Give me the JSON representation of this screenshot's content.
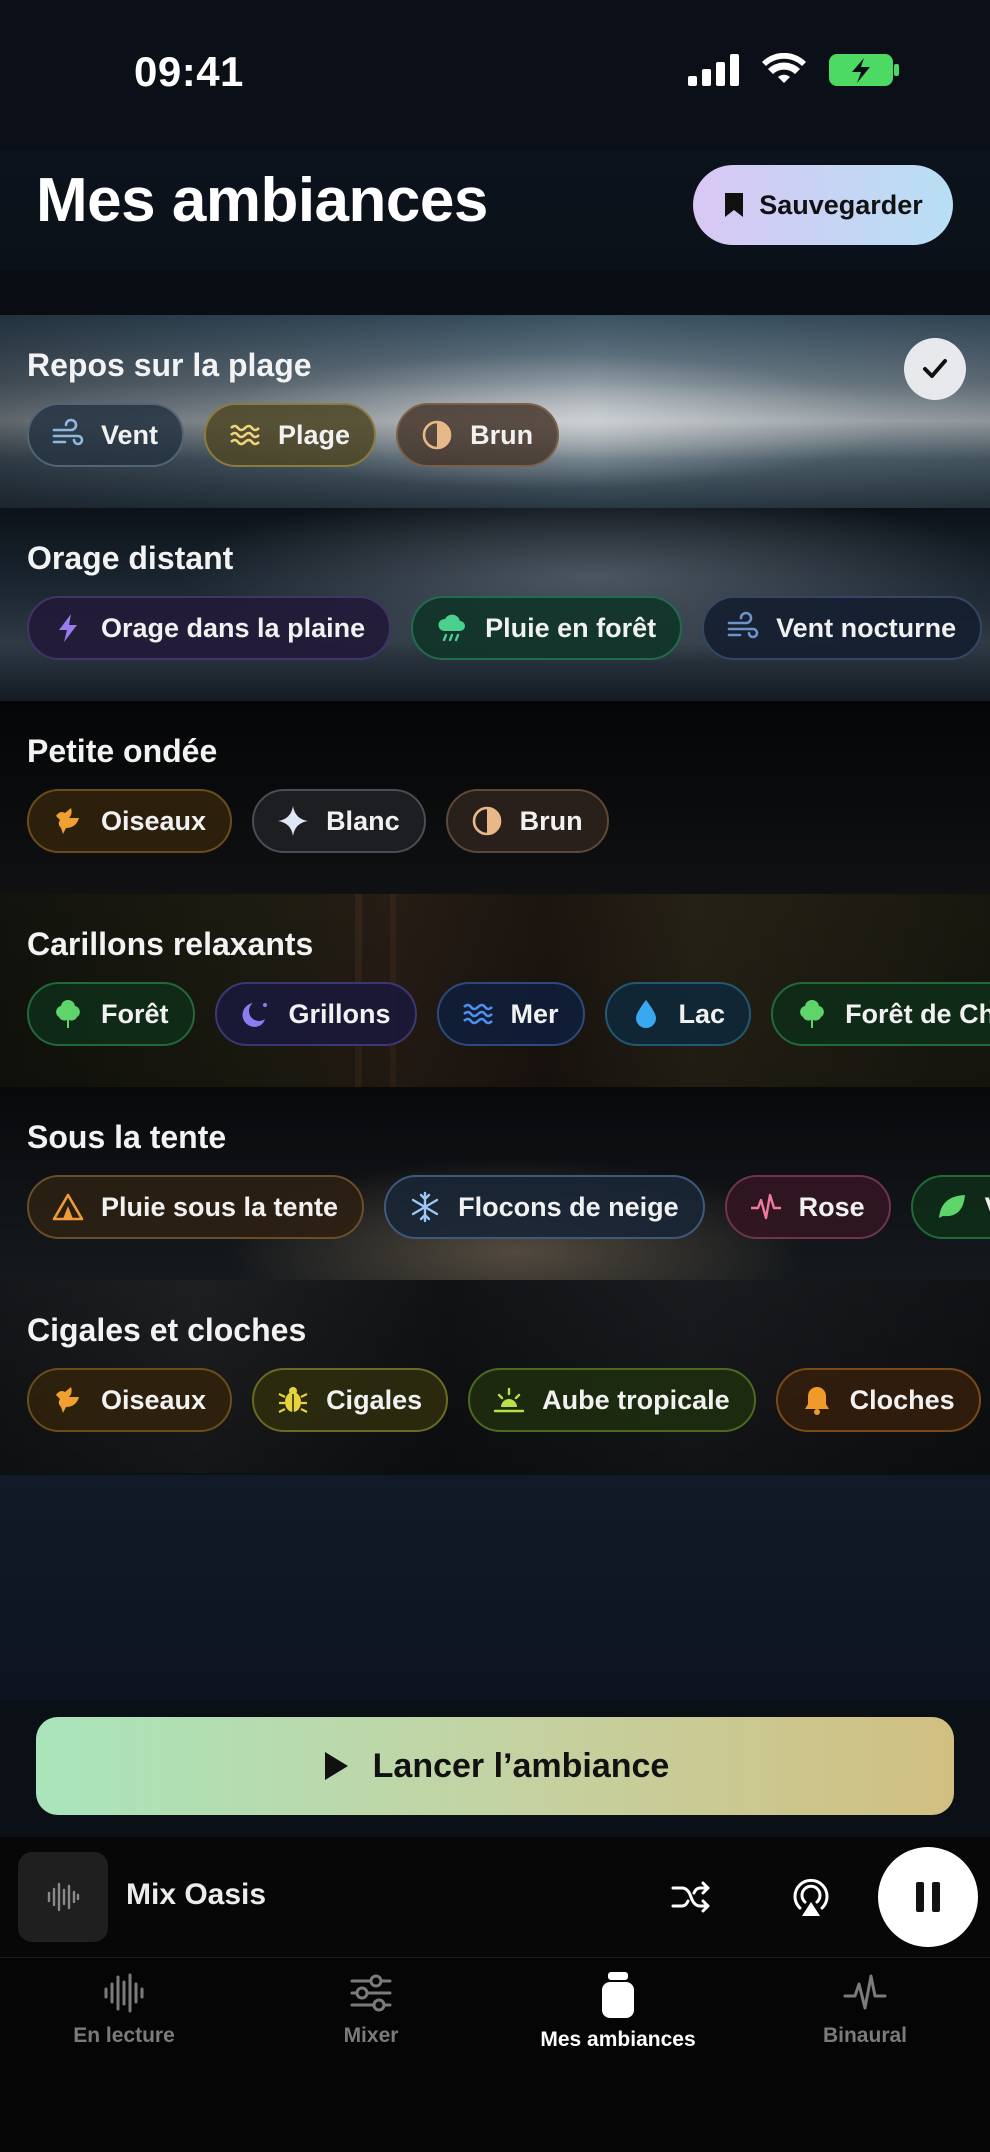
{
  "status_bar": {
    "time": "09:41"
  },
  "header": {
    "title": "Mes ambiances",
    "save_label": "Sauvegarder"
  },
  "ambiances": [
    {
      "title": "Repos sur la plage",
      "selected": true,
      "tags": [
        {
          "label": "Vent",
          "icon": "wind-icon"
        },
        {
          "label": "Plage",
          "icon": "beach-waves-icon"
        },
        {
          "label": "Brun",
          "icon": "half-circle-icon"
        }
      ]
    },
    {
      "title": "Orage distant",
      "tags": [
        {
          "label": "Orage dans la plaine",
          "icon": "lightning-icon"
        },
        {
          "label": "Pluie en forêt",
          "icon": "rain-cloud-icon"
        },
        {
          "label": "Vent nocturne",
          "icon": "wind-icon"
        }
      ]
    },
    {
      "title": "Petite ondée",
      "tags": [
        {
          "label": "Oiseaux",
          "icon": "bird-icon"
        },
        {
          "label": "Blanc",
          "icon": "sparkle-icon"
        },
        {
          "label": "Brun",
          "icon": "half-circle-icon"
        }
      ]
    },
    {
      "title": "Carillons relaxants",
      "tags": [
        {
          "label": "Forêt",
          "icon": "tree-icon"
        },
        {
          "label": "Grillons",
          "icon": "moon-stars-icon"
        },
        {
          "label": "Mer",
          "icon": "waves-icon"
        },
        {
          "label": "Lac",
          "icon": "drop-icon"
        },
        {
          "label": "Forêt de Chil",
          "icon": "tree-icon"
        }
      ]
    },
    {
      "title": "Sous la tente",
      "tags": [
        {
          "label": "Pluie sous la tente",
          "icon": "tent-icon"
        },
        {
          "label": "Flocons de neige",
          "icon": "snowflake-icon"
        },
        {
          "label": "Rose",
          "icon": "pulse-icon"
        },
        {
          "label": "Ve",
          "icon": "leaf-icon"
        }
      ]
    },
    {
      "title": "Cigales et cloches",
      "tags": [
        {
          "label": "Oiseaux",
          "icon": "bird-icon"
        },
        {
          "label": "Cigales",
          "icon": "bug-icon"
        },
        {
          "label": "Aube tropicale",
          "icon": "sunrise-icon"
        },
        {
          "label": "Cloches",
          "icon": "bell-icon"
        }
      ]
    }
  ],
  "launch_label": "Lancer l’ambiance",
  "player": {
    "title": "Mix Oasis"
  },
  "tabs": [
    {
      "label": "En lecture",
      "icon": "waveform-icon"
    },
    {
      "label": "Mixer",
      "icon": "sliders-icon"
    },
    {
      "label": "Mes ambiances",
      "icon": "jar-icon"
    },
    {
      "label": "Binaural",
      "icon": "pulse-icon"
    }
  ],
  "colors": {
    "accent_purple": "#d9c7f4",
    "accent_blue": "#b7dff4",
    "launch_green": "#a9e4bb",
    "launch_gold": "#d1bf81"
  }
}
